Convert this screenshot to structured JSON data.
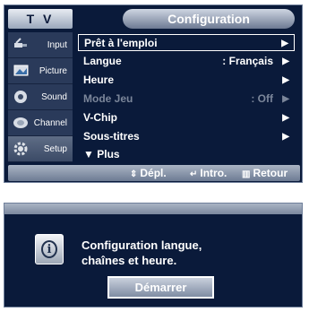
{
  "menu": {
    "tv_label": "T V",
    "title": "Configuration",
    "sidebar": {
      "items": [
        {
          "label": "Input",
          "icon": "input-plug-icon"
        },
        {
          "label": "Picture",
          "icon": "picture-icon"
        },
        {
          "label": "Sound",
          "icon": "speaker-icon"
        },
        {
          "label": "Channel",
          "icon": "satellite-dish-icon"
        },
        {
          "label": "Setup",
          "icon": "gear-icon",
          "active": true
        }
      ]
    },
    "rows": [
      {
        "label": "Prêt à l'emploi",
        "value": "",
        "arrow": "▶",
        "selected": true
      },
      {
        "label": "Langue",
        "value": ": Français",
        "arrow": "▶"
      },
      {
        "label": "Heure",
        "value": "",
        "arrow": "▶"
      },
      {
        "label": "Mode Jeu",
        "value": ": Off",
        "arrow": "▶",
        "disabled": true
      },
      {
        "label": "V-Chip",
        "value": "",
        "arrow": "▶"
      },
      {
        "label": "Sous-titres",
        "value": "",
        "arrow": "▶"
      },
      {
        "label": "Plus",
        "glyph": "▼"
      }
    ],
    "hints": {
      "move": "Dépl.",
      "move_glyph": "⇕",
      "enter": "Intro.",
      "enter_glyph": "↵",
      "back": "Retour",
      "back_glyph": "▥"
    }
  },
  "message": {
    "line1": "Configuration langue,",
    "line2": "chaînes et heure.",
    "button_label": "Démarrer",
    "icon": "info-icon"
  },
  "colors": {
    "panel": "#0a1a3a",
    "accent": "#6d7a93",
    "text": "#ffffff"
  }
}
